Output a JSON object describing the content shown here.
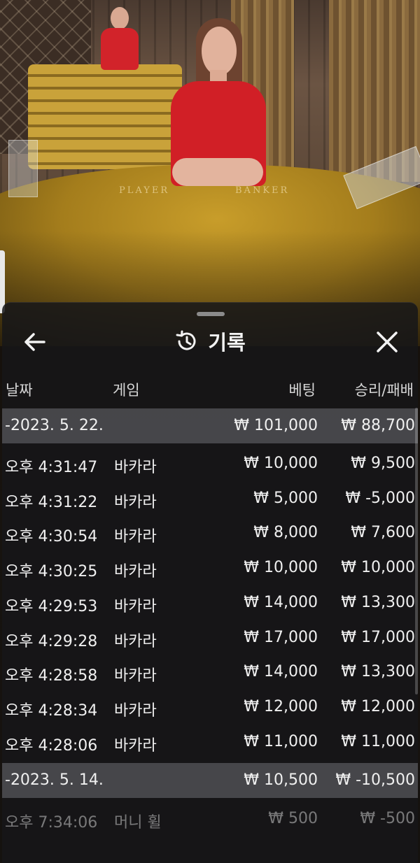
{
  "table": {
    "player_label": "PLAYER",
    "banker_label": "BANKER"
  },
  "header": {
    "title": "기록",
    "back_icon": "arrow-left-icon",
    "history_icon": "history-icon",
    "close_icon": "close-icon"
  },
  "columns": {
    "date": "날짜",
    "game": "게임",
    "bet": "베팅",
    "win_loss": "승리/패배"
  },
  "groups": [
    {
      "date": "-2023. 5. 22.",
      "bet": "₩ 101,000",
      "win": "₩ 88,700",
      "rows": [
        {
          "time": "오후 4:31:47",
          "game": "바카라",
          "bet": "₩ 10,000",
          "win": "₩ 9,500"
        },
        {
          "time": "오후 4:31:22",
          "game": "바카라",
          "bet": "₩ 5,000",
          "win": "₩ -5,000"
        },
        {
          "time": "오후 4:30:54",
          "game": "바카라",
          "bet": "₩ 8,000",
          "win": "₩ 7,600"
        },
        {
          "time": "오후 4:30:25",
          "game": "바카라",
          "bet": "₩ 10,000",
          "win": "₩ 10,000"
        },
        {
          "time": "오후 4:29:53",
          "game": "바카라",
          "bet": "₩ 14,000",
          "win": "₩ 13,300"
        },
        {
          "time": "오후 4:29:28",
          "game": "바카라",
          "bet": "₩ 17,000",
          "win": "₩ 17,000"
        },
        {
          "time": "오후 4:28:58",
          "game": "바카라",
          "bet": "₩ 14,000",
          "win": "₩ 13,300"
        },
        {
          "time": "오후 4:28:34",
          "game": "바카라",
          "bet": "₩ 12,000",
          "win": "₩ 12,000"
        },
        {
          "time": "오후 4:28:06",
          "game": "바카라",
          "bet": "₩ 11,000",
          "win": "₩ 11,000"
        }
      ]
    },
    {
      "date": "-2023. 5. 14.",
      "bet": "₩ 10,500",
      "win": "₩ -10,500",
      "rows": [
        {
          "time": "오후 7:34:06",
          "game": "머니 휠",
          "bet": "₩ 500",
          "win": "₩ -500"
        }
      ]
    }
  ]
}
